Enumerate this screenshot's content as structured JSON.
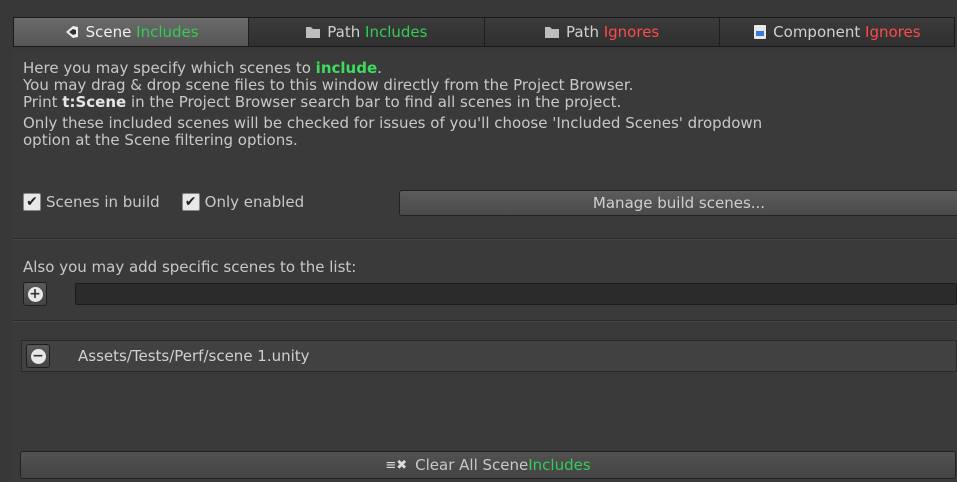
{
  "tabs": [
    {
      "label": "Scene",
      "suffix": "Includes",
      "suffix_color": "green",
      "icon": "unity-scene-icon",
      "active": true
    },
    {
      "label": "Path",
      "suffix": "Includes",
      "suffix_color": "green",
      "icon": "folder-icon",
      "active": false
    },
    {
      "label": "Path",
      "suffix": "Ignores",
      "suffix_color": "red",
      "icon": "folder-icon",
      "active": false
    },
    {
      "label": "Component",
      "suffix": "Ignores",
      "suffix_color": "red",
      "icon": "script-component-icon",
      "active": false
    }
  ],
  "info": {
    "line1_pre": "Here you may specify which scenes to ",
    "line1_keyword": "include",
    "line1_post": ".",
    "line2": "You may drag & drop scene files to this window directly from the Project Browser.",
    "line3_pre": "Print ",
    "line3_keyword": "t:Scene",
    "line3_post": " in the Project Browser search bar to find all scenes in the project.",
    "line4": "Only these included scenes will be checked for issues of you'll choose 'Included Scenes' dropdown",
    "line5": "option at the Scene filtering options."
  },
  "options": {
    "scenes_in_build_label": "Scenes in build",
    "scenes_in_build_checked": true,
    "only_enabled_label": "Only enabled",
    "only_enabled_checked": true,
    "manage_button_label": "Manage build scenes..."
  },
  "add_section": {
    "label": "Also you may add specific scenes to the list:",
    "field_value": ""
  },
  "scenes": [
    {
      "path": "Assets/Tests/Perf/scene 1.unity"
    }
  ],
  "clear_button": {
    "label_pre": "Clear All Scene ",
    "label_keyword": "Includes",
    "icon": "clear-list-icon"
  },
  "colors": {
    "accent_green": "#33cc55",
    "accent_red": "#ff4a4a",
    "background": "#383838"
  }
}
